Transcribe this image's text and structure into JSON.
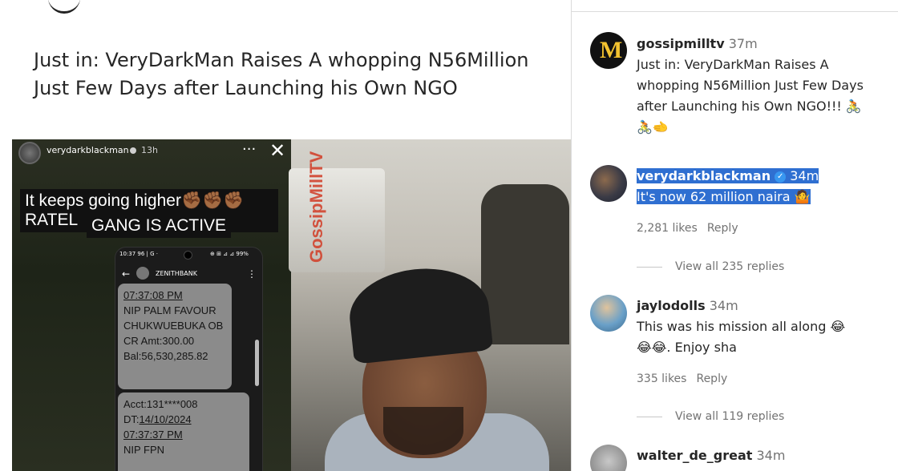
{
  "post": {
    "title": "Just in: VeryDarkMan Raises A whopping N56Million Just Few Days after Launching his Own NGO"
  },
  "story": {
    "username": "verydarkblackman",
    "time": "13h",
    "more": "···",
    "close": "✕",
    "caption_line1": "It keeps going higher✊🏾✊🏾✊🏾 RATEL",
    "caption_line2": "GANG IS ACTIVE",
    "watermark": "GossipMillTV",
    "phone": {
      "status_left": "10:37 96 | G ·",
      "status_right": "⊕ ⊞ ⊿ ⊿ 99%",
      "back": "←",
      "bank": "ZENITHBANK",
      "menu": "⋮",
      "msg1": {
        "time": "07:37:08 PM",
        "line1": "NIP PALM FAVOUR",
        "line2": "CHUKWUEBUKA OB",
        "line3": "CR Amt:300.00",
        "line4": "Bal:56,530,285.82"
      },
      "msg2": {
        "acct": "Acct:131****008",
        "dt_label": "DT:",
        "dt": "14/10/2024",
        "time": "07:37:37 PM",
        "line": "NIP FPN"
      }
    }
  },
  "comments": [
    {
      "username": "gossipmilltv",
      "time": "37m",
      "text_line1": "Just in: VeryDarkMan Raises A",
      "text_line2": "whopping N56Million Just Few Days",
      "text_line3": "after Launching his Own NGO!!! 🚴",
      "text_line4": "🚴🫲",
      "avatar_letter": "M"
    },
    {
      "username": "verydarkblackman",
      "verified": "✓",
      "time": "34m",
      "text": "It's now 62 million naira 🤷",
      "likes": "2,281 likes",
      "reply": "Reply",
      "view_replies": "View all 235 replies"
    },
    {
      "username": "jaylodolls",
      "time": "34m",
      "text_line1": "This was his mission all along 😂",
      "text_line2": "😂😂. Enjoy sha",
      "likes": "335 likes",
      "reply": "Reply",
      "view_replies": "View all 119 replies"
    },
    {
      "username": "walter_de_great",
      "time": "34m"
    }
  ],
  "colors": {
    "highlight": "#2f6fd1",
    "watermark": "#d2442f",
    "verified": "#3897f0"
  }
}
